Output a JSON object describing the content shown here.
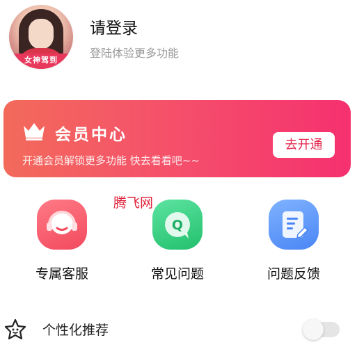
{
  "profile": {
    "avatar_badge": "女神驾到",
    "login_title": "请登录",
    "login_subtitle": "登陆体验更多功能"
  },
  "vip": {
    "title": "会员中心",
    "description": "开通会员解锁更多功能 快去看看吧~~",
    "button_label": "去开通",
    "gradient_start": "#f36a5b",
    "gradient_end": "#f5316f"
  },
  "watermark": "腾飞网",
  "features": [
    {
      "label": "专属客服",
      "icon": "headset-icon",
      "color": "#f24a5e"
    },
    {
      "label": "常见问题",
      "icon": "faq-chat-icon",
      "color": "#22c06d"
    },
    {
      "label": "问题反馈",
      "icon": "feedback-document-icon",
      "color": "#4a86f5"
    }
  ],
  "settings": {
    "recommend_label": "个性化推荐",
    "recommend_enabled": false
  }
}
